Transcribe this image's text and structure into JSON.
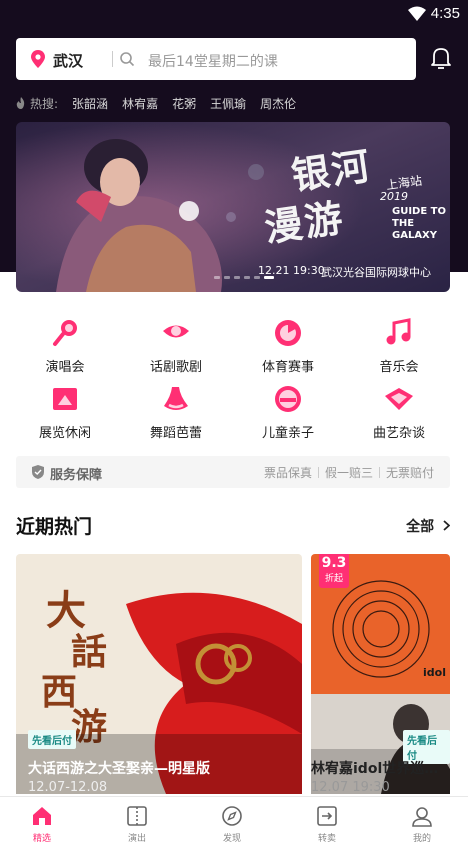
{
  "status_bar": {
    "time": "4:35"
  },
  "search": {
    "city": "武汉",
    "placeholder": "最后14堂星期二的课"
  },
  "hot_search": {
    "label": "热搜:",
    "items": [
      "张韶涵",
      "林宥嘉",
      "花粥",
      "王佩瑜",
      "周杰伦"
    ]
  },
  "banner": {
    "title_line1": "银河",
    "title_line2": "漫游",
    "station": "上海站",
    "year": "2019",
    "guide": "GUIDE TO THE GALAXY",
    "date": "12.21 19:30",
    "venue": "武汉光谷国际网球中心"
  },
  "categories": [
    {
      "label": "演唱会",
      "icon": "microphone-icon"
    },
    {
      "label": "话剧歌剧",
      "icon": "theater-mask-icon"
    },
    {
      "label": "体育赛事",
      "icon": "sports-ball-icon"
    },
    {
      "label": "音乐会",
      "icon": "music-note-icon"
    },
    {
      "label": "展览休闲",
      "icon": "exhibition-frame-icon"
    },
    {
      "label": "舞蹈芭蕾",
      "icon": "dance-icon"
    },
    {
      "label": "儿童亲子",
      "icon": "kids-icon"
    },
    {
      "label": "曲艺杂谈",
      "icon": "folk-art-icon"
    }
  ],
  "service": {
    "title": "服务保障",
    "items": [
      "票品保真",
      "假一赔三",
      "无票赔付"
    ]
  },
  "section": {
    "title": "近期热门",
    "all_label": "全部"
  },
  "cards": [
    {
      "title": "大话西游之大圣娶亲—明星版",
      "date": "12.07-12.08",
      "tag": "先看后付"
    },
    {
      "title": "林宥嘉idol世界巡回演…",
      "date": "12.07 19:30",
      "tag": "先看后付",
      "discount": "9.3",
      "discount_label": "折起"
    }
  ],
  "tabs": [
    {
      "label": "精选",
      "icon": "home-icon",
      "active": true
    },
    {
      "label": "演出",
      "icon": "ticket-icon",
      "active": false
    },
    {
      "label": "发现",
      "icon": "compass-icon",
      "active": false
    },
    {
      "label": "转卖",
      "icon": "transfer-icon",
      "active": false
    },
    {
      "label": "我的",
      "icon": "user-icon",
      "active": false
    }
  ],
  "colors": {
    "accent": "#ff2f74",
    "header_bg": "#150c1e",
    "tag_text": "#1a8a84"
  }
}
